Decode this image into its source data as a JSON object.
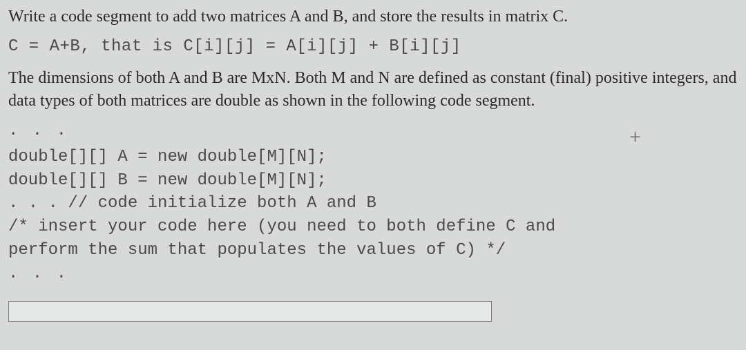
{
  "paragraphs": {
    "intro": "Write a code segment to add two matrices A and B, and store the results in matrix C.",
    "dims": "The dimensions of both A and B are MxN. Both M and N are defined as constant (final) positive integers, and data types of both matrices are double as shown in the following code segment."
  },
  "formula": {
    "left": "C = A+B,",
    "mid_text": " that is ",
    "expr": "C[i][j] = A[i][j] + B[i][j]"
  },
  "ellipsis": ". . .",
  "code": {
    "l1": "double[][] A = new double[M][N];",
    "l2": "double[][] B = new double[M][N];",
    "l3": ". . . // code initialize both A and B",
    "l4": "/* insert your code here (you need to both define C and",
    "l5": "perform the sum that populates the values of C) */"
  },
  "icons": {
    "plus": "+"
  },
  "answer": {
    "value": ""
  }
}
